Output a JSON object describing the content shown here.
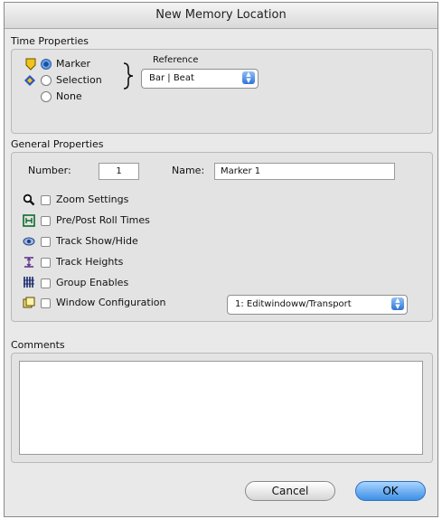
{
  "window": {
    "title": "New Memory Location"
  },
  "time_properties": {
    "label": "Time Properties",
    "options": [
      {
        "label": "Marker",
        "selected": true,
        "icon": "marker-shield-icon"
      },
      {
        "label": "Selection",
        "selected": false,
        "icon": "selection-diamond-icon"
      },
      {
        "label": "None",
        "selected": false,
        "icon": ""
      }
    ],
    "reference_label": "Reference",
    "reference_value": "Bar | Beat"
  },
  "general_properties": {
    "label": "General Properties",
    "number_label": "Number:",
    "number_value": "1",
    "name_label": "Name:",
    "name_value": "Marker 1",
    "checkboxes": [
      {
        "label": "Zoom Settings",
        "checked": false,
        "icon": "magnifier-icon"
      },
      {
        "label": "Pre/Post Roll Times",
        "checked": false,
        "icon": "pre-post-roll-icon"
      },
      {
        "label": "Track Show/Hide",
        "checked": false,
        "icon": "eye-icon"
      },
      {
        "label": "Track Heights",
        "checked": false,
        "icon": "track-heights-icon"
      },
      {
        "label": "Group Enables",
        "checked": false,
        "icon": "group-enables-icon"
      },
      {
        "label": "Window Configuration",
        "checked": false,
        "icon": "window-config-icon"
      }
    ],
    "window_config_value": "1: Editwindoww/Transport"
  },
  "comments": {
    "label": "Comments",
    "value": ""
  },
  "buttons": {
    "cancel": "Cancel",
    "ok": "OK"
  },
  "colors": {
    "accent": "#3d8fe6",
    "background": "#e9e9e9",
    "marker_yellow": "#f0c419",
    "selection_blue": "#2a55c0"
  }
}
